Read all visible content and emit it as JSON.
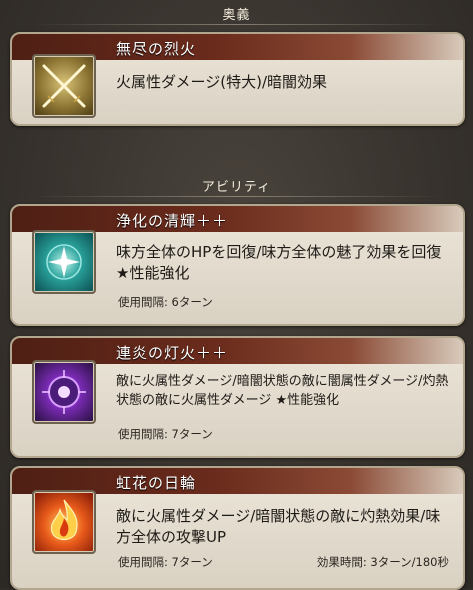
{
  "ougi_header": "奥義",
  "ability_header": "アビリティ",
  "ougi": {
    "title": "無尽の烈火",
    "description": "火属性ダメージ(特大)/暗闇効果",
    "icon": "crossed-swords-icon"
  },
  "abilities": [
    {
      "title": "浄化の清輝＋＋",
      "description": "味方全体のHPを回復/味方全体の魅了効果を回復 ★性能強化",
      "cooldown": "使用間隔: 6ターン",
      "icon": "sparkle-heal-icon"
    },
    {
      "title": "連炎の灯火＋＋",
      "description": "敵に火属性ダメージ/暗闇状態の敵に闇属性ダメージ/灼熱状態の敵に火属性ダメージ ★性能強化",
      "cooldown": "使用間隔: 7ターン",
      "icon": "purple-burst-icon"
    },
    {
      "title": "虹花の日輪",
      "description": "敵に火属性ダメージ/暗闇状態の敵に灼熱効果/味方全体の攻撃UP",
      "cooldown": "使用間隔: 7ターン",
      "effect_duration": "効果時間: 3ターン/180秒",
      "icon": "flame-icon"
    }
  ]
}
